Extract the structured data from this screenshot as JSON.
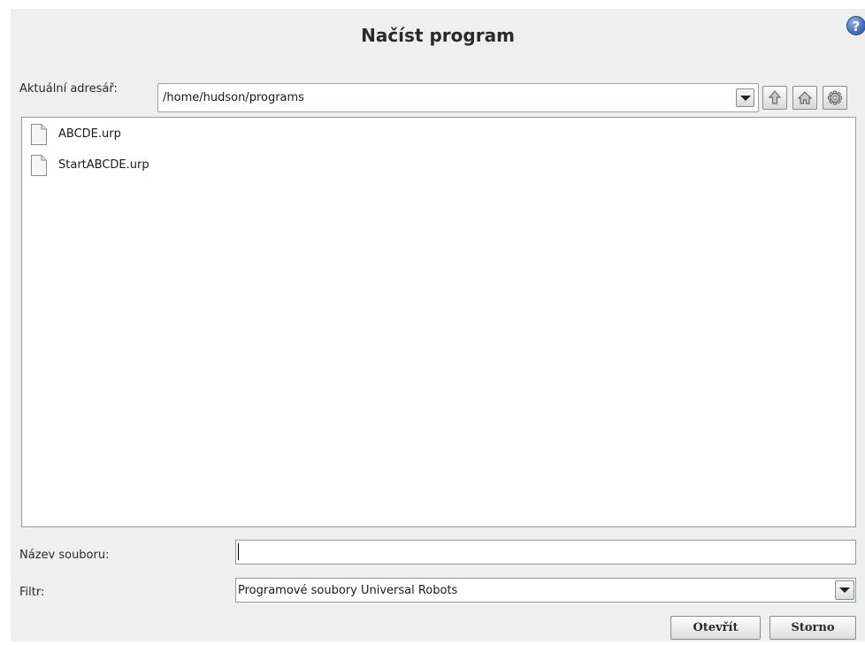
{
  "dialog": {
    "title": "Načíst program",
    "help_icon": "question-circle-icon",
    "help_glyph": "?"
  },
  "directory": {
    "label": "Aktuální adresář:",
    "value": "/home/hudson/programs",
    "dropdown_icon": "chevron-down-icon",
    "buttons": {
      "up": "arrow-up-icon",
      "home": "home-icon",
      "settings": "gear-icon"
    }
  },
  "files": [
    {
      "name": "ABCDE.urp",
      "icon": "document-icon"
    },
    {
      "name": "StartABCDE.urp",
      "icon": "document-icon"
    }
  ],
  "filename": {
    "label": "Název souboru:",
    "value": "",
    "placeholder": ""
  },
  "filter": {
    "label": "Filtr:",
    "value": "Programové soubory Universal Robots"
  },
  "actions": {
    "open_label": "Otevřít",
    "cancel_label": "Storno"
  },
  "colors": {
    "dialog_bg": "#efefef",
    "help_blue": "#4a74c0",
    "border": "#9a9a9a"
  }
}
